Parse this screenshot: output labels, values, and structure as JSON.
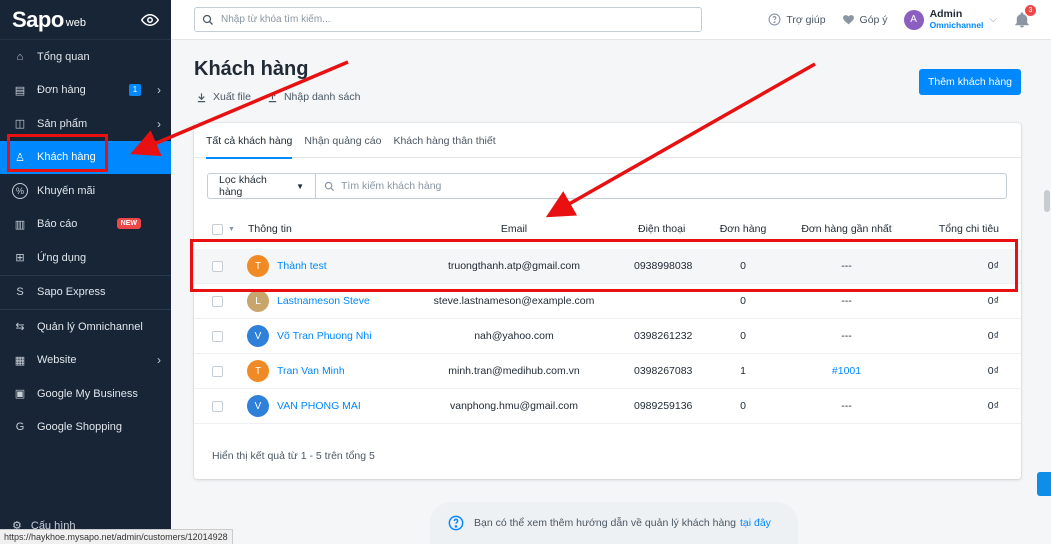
{
  "brand": {
    "logo": "Sapo",
    "logo_sub": "web"
  },
  "sidebar": {
    "items": [
      {
        "label": "Tổng quan",
        "icon": "home-icon"
      },
      {
        "label": "Đơn hàng",
        "icon": "orders-icon",
        "badge": "1",
        "chevron": true
      },
      {
        "label": "Sản phẩm",
        "icon": "product-icon",
        "chevron": true
      },
      {
        "label": "Khách hàng",
        "icon": "user-icon",
        "active": true
      },
      {
        "label": "Khuyến mãi",
        "icon": "percent-icon"
      },
      {
        "label": "Báo cáo",
        "icon": "chart-icon",
        "badge_new": "NEW"
      },
      {
        "label": "Ứng dụng",
        "icon": "apps-icon"
      },
      {
        "label": "Sapo Express",
        "icon": "express-icon"
      },
      {
        "label": "Quản lý Omnichannel",
        "icon": "omnichannel-icon"
      },
      {
        "label": "Website",
        "icon": "website-icon",
        "chevron": true
      },
      {
        "label": "Google My Business",
        "icon": "store-icon"
      },
      {
        "label": "Google Shopping",
        "icon": "google-icon"
      }
    ],
    "config_label": "Cấu hình",
    "status_url": "https://haykhoe.mysapo.net/admin/customers/12014928"
  },
  "topbar": {
    "search_placeholder": "Nhập từ khóa tìm kiếm...",
    "help": "Trợ giúp",
    "feedback": "Góp ý",
    "user_initial": "A",
    "user_name": "Admin",
    "user_role": "Omnichannel",
    "notifications": "3"
  },
  "page": {
    "title": "Khách hàng",
    "export": "Xuất file",
    "import": "Nhập danh sách",
    "add_button": "Thêm khách hàng"
  },
  "tabs": [
    "Tất cả khách hàng",
    "Nhận quảng cáo",
    "Khách hàng thân thiết"
  ],
  "filter": {
    "button": "Lọc khách hàng",
    "search_placeholder": "Tìm kiếm khách hàng"
  },
  "table": {
    "headers": {
      "info": "Thông tin",
      "email": "Email",
      "phone": "Điện thoại",
      "orders": "Đơn hàng",
      "last_order": "Đơn hàng gần nhất",
      "total": "Tổng chi tiêu"
    },
    "rows": [
      {
        "initial": "T",
        "color": "#f08a24",
        "name": "Thành test",
        "email": "truongthanh.atp@gmail.com",
        "phone": "0938998038",
        "orders": "0",
        "last_order": "---",
        "total": "0₫"
      },
      {
        "initial": "L",
        "color": "#c8a66b",
        "name": "Lastnameson Steve",
        "email": "steve.lastnameson@example.com",
        "phone": "",
        "orders": "0",
        "last_order": "---",
        "total": "0₫"
      },
      {
        "initial": "V",
        "color": "#2f80d8",
        "name": "Võ Tran Phuong Nhi",
        "email": "nah@yahoo.com",
        "phone": "0398261232",
        "orders": "0",
        "last_order": "---",
        "total": "0₫"
      },
      {
        "initial": "T",
        "color": "#f08a24",
        "name": "Tran Van Minh",
        "email": "minh.tran@medihub.com.vn",
        "phone": "0398267083",
        "orders": "1",
        "last_order": "#1001",
        "total": "0₫"
      },
      {
        "initial": "V",
        "color": "#2f80d8",
        "name": "VAN PHONG MAI",
        "email": "vanphong.hmu@gmail.com",
        "phone": "0989259136",
        "orders": "0",
        "last_order": "---",
        "total": "0₫"
      }
    ],
    "footer": "Hiển thị kết quả từ 1 - 5 trên tổng 5"
  },
  "help": {
    "text": "Bạn có thể xem thêm hướng dẫn về quản lý khách hàng",
    "link": "tại đây"
  },
  "colors": {
    "accent": "#0088ff",
    "sidebar_bg": "#182537",
    "annotation": "#e81010"
  }
}
